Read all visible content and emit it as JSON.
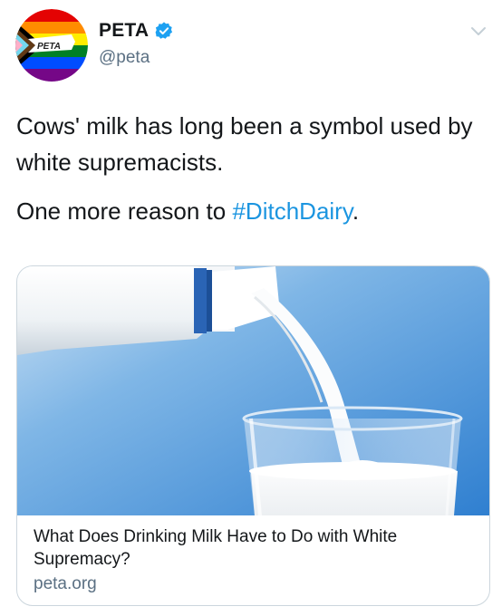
{
  "author": {
    "display_name": "PETA",
    "handle": "@peta",
    "avatar_text": "PETA",
    "verified": true
  },
  "tweet": {
    "line1": "Cows' milk has long been a symbol used by white supremacists.",
    "line2_prefix": "One more reason to ",
    "hashtag": "#DitchDairy",
    "line2_suffix": "."
  },
  "card": {
    "title": "What Does Drinking Milk Have to Do with White Supremacy?",
    "domain": "peta.org",
    "image_icon": "milk-pouring-image"
  },
  "colors": {
    "link": "#1b95e0",
    "secondary_text": "#5b7083",
    "verified_badge": "#1da1f2",
    "card_border": "#ccd6dd"
  },
  "icons": {
    "verified": "verified-badge-icon",
    "menu": "chevron-down-icon"
  }
}
